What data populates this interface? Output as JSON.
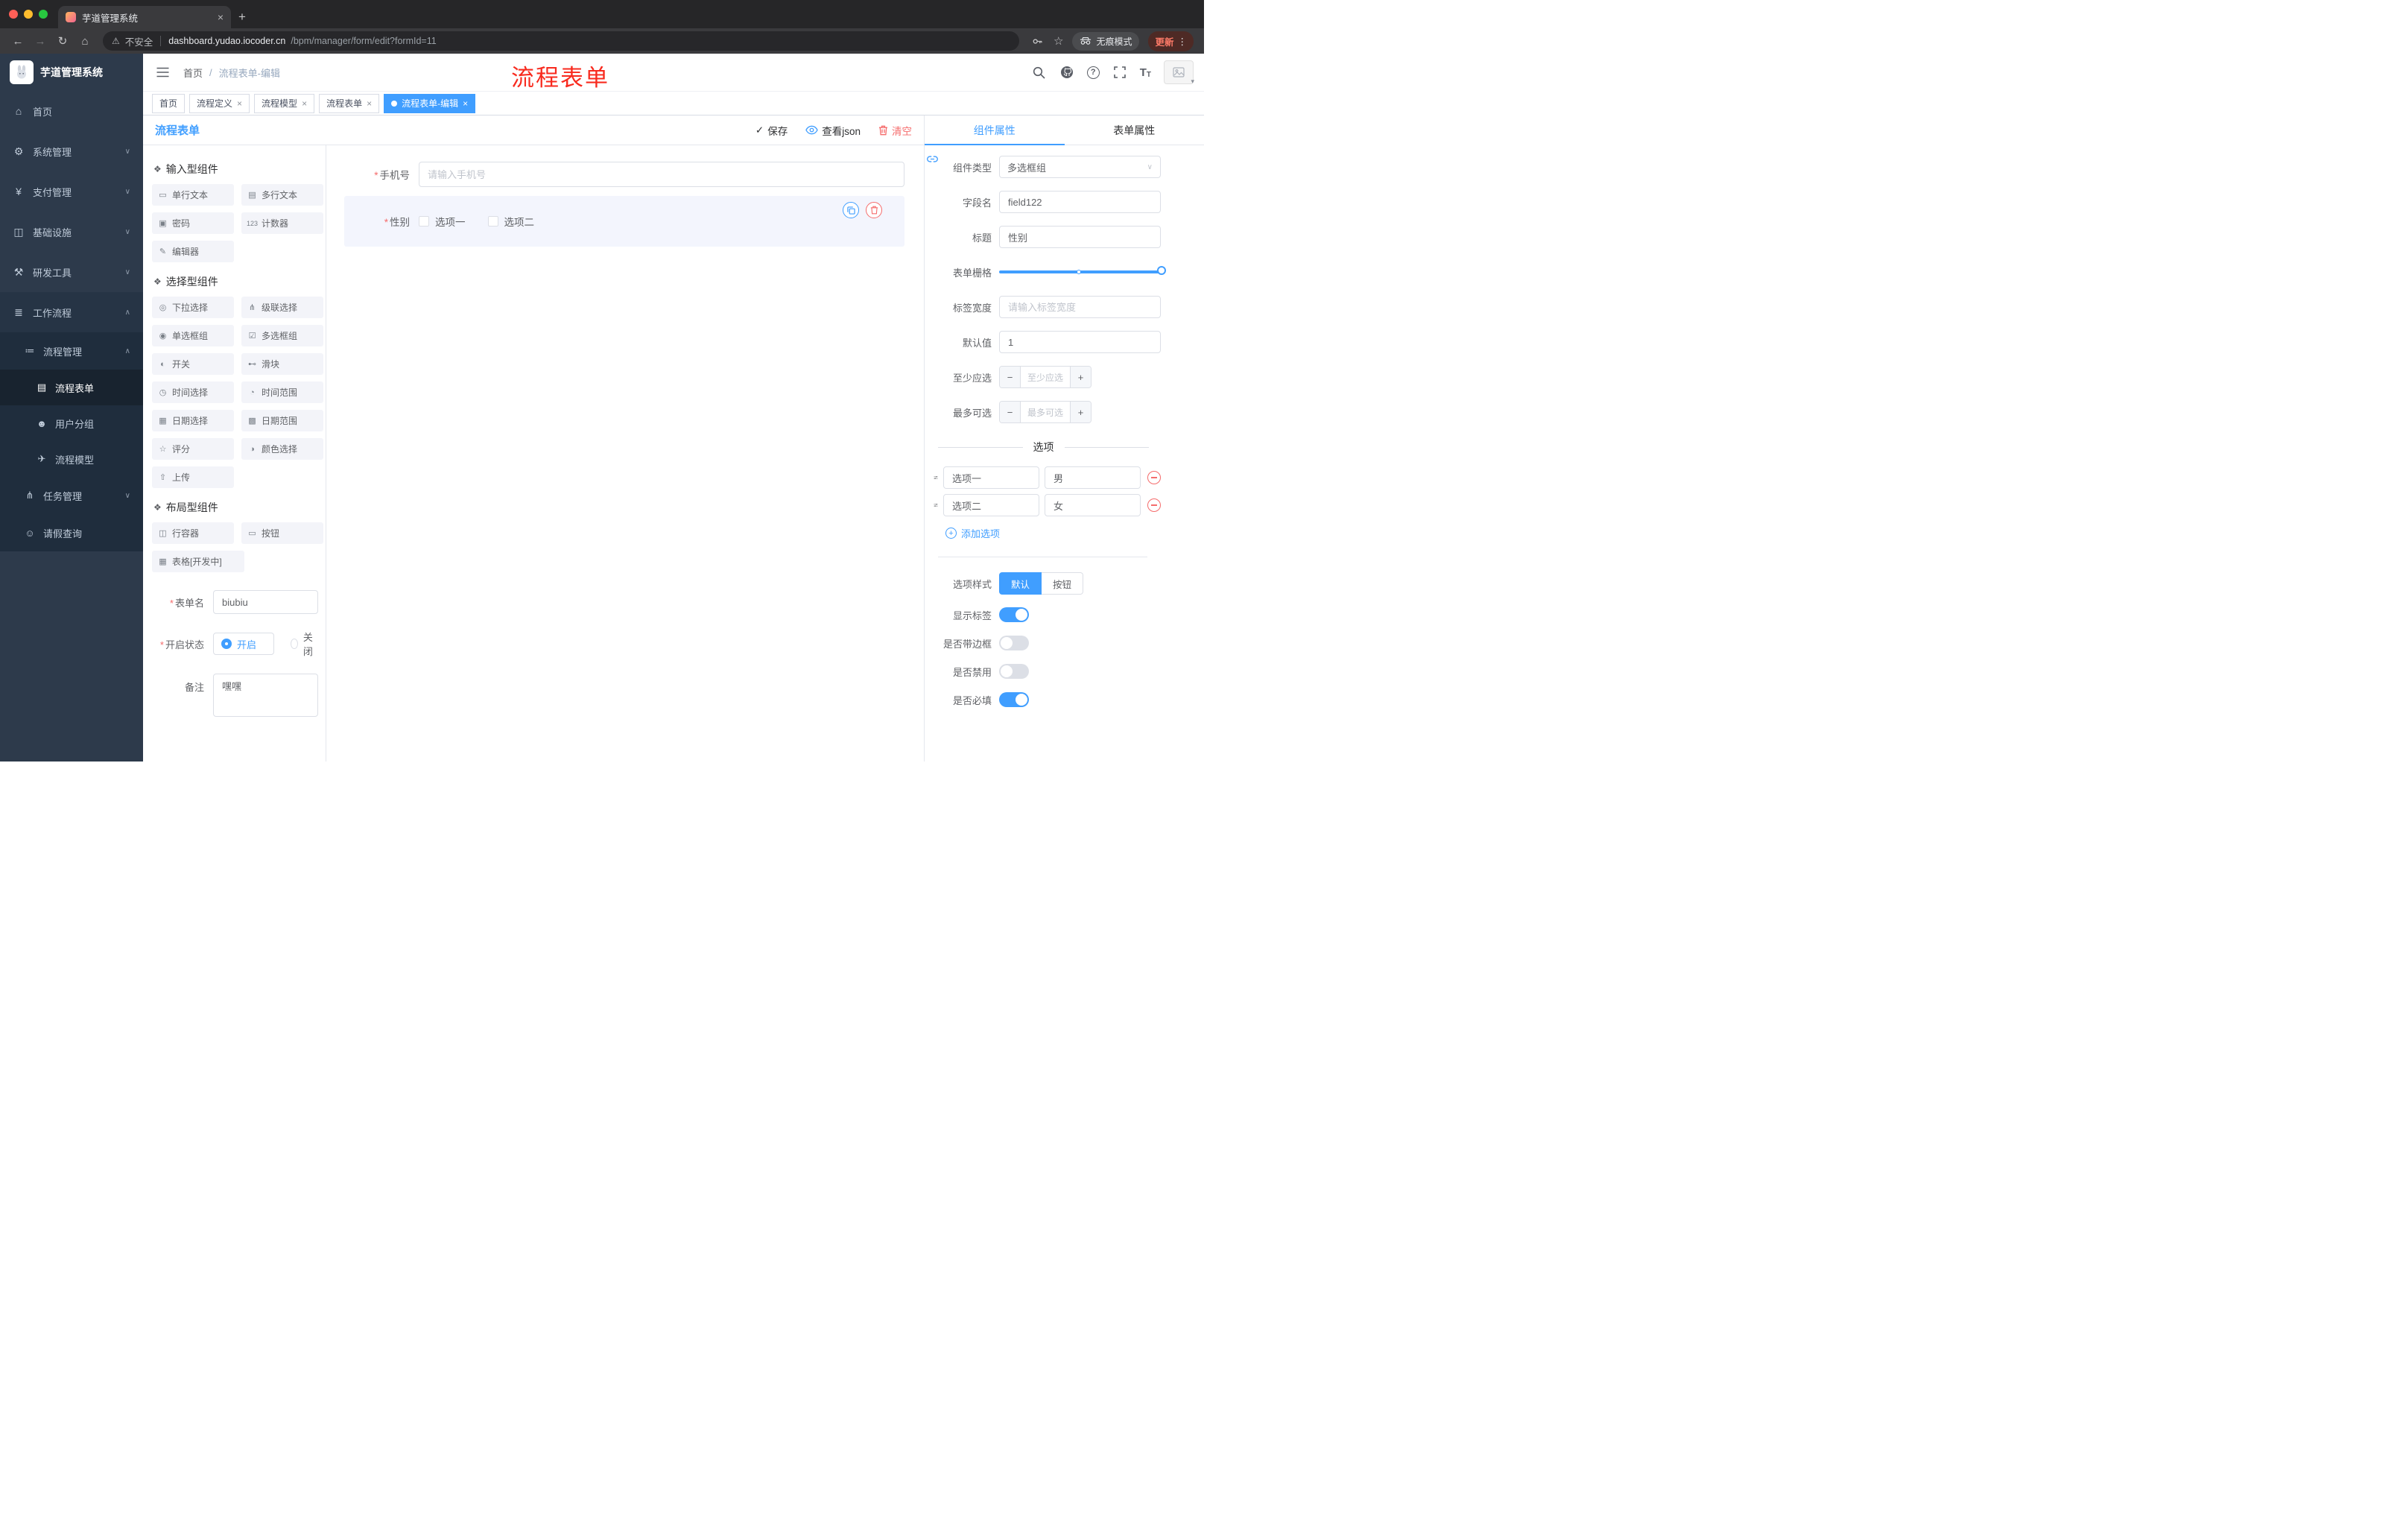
{
  "browser": {
    "tab_title": "芋道管理系统",
    "security_label": "不安全",
    "url_host": "dashboard.yudao.iocoder.cn",
    "url_path": "/bpm/manager/form/edit?formId=11",
    "incognito_label": "无痕模式",
    "update_label": "更新"
  },
  "sidebar": {
    "logo_title": "芋道管理系统",
    "items": [
      {
        "label": "首页"
      },
      {
        "label": "系统管理"
      },
      {
        "label": "支付管理"
      },
      {
        "label": "基础设施"
      },
      {
        "label": "研发工具"
      },
      {
        "label": "工作流程"
      }
    ],
    "sub": {
      "process_mgmt": "流程管理",
      "process_form": "流程表单",
      "user_group": "用户分组",
      "process_model": "流程模型",
      "task_mgmt": "任务管理",
      "leave_query": "请假查询"
    }
  },
  "header": {
    "breadcrumb_home": "首页",
    "breadcrumb_sep": "/",
    "breadcrumb_current": "流程表单-编辑",
    "annotation": "流程表单"
  },
  "tags": [
    {
      "label": "首页"
    },
    {
      "label": "流程定义"
    },
    {
      "label": "流程模型"
    },
    {
      "label": "流程表单"
    },
    {
      "label": "流程表单-编辑"
    }
  ],
  "designer": {
    "title": "流程表单",
    "save": "保存",
    "view_json": "查看json",
    "clear": "清空"
  },
  "palette": {
    "sections": [
      {
        "title": "输入型组件",
        "items": [
          "单行文本",
          "多行文本",
          "密码",
          "计数器",
          "编辑器"
        ]
      },
      {
        "title": "选择型组件",
        "items": [
          "下拉选择",
          "级联选择",
          "单选框组",
          "多选框组",
          "开关",
          "滑块",
          "时间选择",
          "时间范围",
          "日期选择",
          "日期范围",
          "评分",
          "颜色选择",
          "上传"
        ]
      },
      {
        "title": "布局型组件",
        "items": [
          "行容器",
          "按钮",
          "表格[开发中]"
        ]
      }
    ]
  },
  "meta": {
    "form_name_label": "表单名",
    "form_name_value": "biubiu",
    "status_label": "开启状态",
    "status_on": "开启",
    "status_off": "关闭",
    "remark_label": "备注",
    "remark_value": "嘿嘿"
  },
  "canvas": {
    "phone_label": "手机号",
    "phone_placeholder": "请输入手机号",
    "gender_label": "性别",
    "gender_opt1": "选项一",
    "gender_opt2": "选项二"
  },
  "props": {
    "tab_component": "组件属性",
    "tab_form": "表单属性",
    "component_type_label": "组件类型",
    "component_type_value": "多选框组",
    "field_label": "字段名",
    "field_value": "field122",
    "title_label": "标题",
    "title_value": "性别",
    "grid_label": "表单栅格",
    "width_label": "标签宽度",
    "width_placeholder": "请输入标签宽度",
    "default_label": "默认值",
    "default_value": "1",
    "min_label": "至少应选",
    "min_placeholder": "至少应选",
    "max_label": "最多可选",
    "max_placeholder": "最多可选",
    "options_divider": "选项",
    "opt1_label": "选项一",
    "opt1_value": "男",
    "opt2_label": "选项二",
    "opt2_value": "女",
    "add_option": "添加选项",
    "style_label": "选项样式",
    "style_default": "默认",
    "style_button": "按钮",
    "show_label": "显示标签",
    "border_label": "是否带边框",
    "disabled_label": "是否禁用",
    "required_label": "是否必填"
  },
  "icons": {
    "back": "←",
    "forward": "→",
    "reload": "↻",
    "home": "⌂",
    "warning": "⚠",
    "star": "☆",
    "more": "⋮",
    "new_tab": "+",
    "close": "×",
    "help": "?",
    "font_big": "T",
    "font_small": "T",
    "menu_home": "⌂",
    "menu_system": "⚙",
    "menu_pay": "¥",
    "menu_infra": "◫",
    "menu_dev": "⚒",
    "menu_flow": "≣",
    "menu_pm": "≔",
    "menu_form": "▤",
    "menu_group": "☻",
    "menu_model": "✈",
    "menu_task": "⋔",
    "menu_leave": "☺",
    "chev_down": "∨",
    "chev_up": "∧",
    "caret": "▾",
    "check": "✓",
    "section": "❖",
    "select_arrow": "∨",
    "minus": "−",
    "plus": "+",
    "p_text": "▭",
    "p_textarea": "▤",
    "p_password": "▣",
    "p_counter": "123",
    "p_editor": "✎",
    "p_select": "◎",
    "p_cascader": "⋔",
    "p_radio": "◉",
    "p_checkbox": "☑",
    "p_switch": "◐",
    "p_slider": "⊷",
    "p_time": "◷",
    "p_timerange": "◔",
    "p_date": "▦",
    "p_daterange": "▩",
    "p_rate": "☆",
    "p_color": "◑",
    "p_upload": "⇧",
    "p_row": "◫",
    "p_button": "▭",
    "p_table": "▦"
  },
  "colors": {
    "primary": "#409eff",
    "danger": "#f56c6c",
    "annotation_red": "#f82a1e",
    "sidebar_bg": "#2d3a4b",
    "submenu_bg": "#1f2d3d"
  }
}
